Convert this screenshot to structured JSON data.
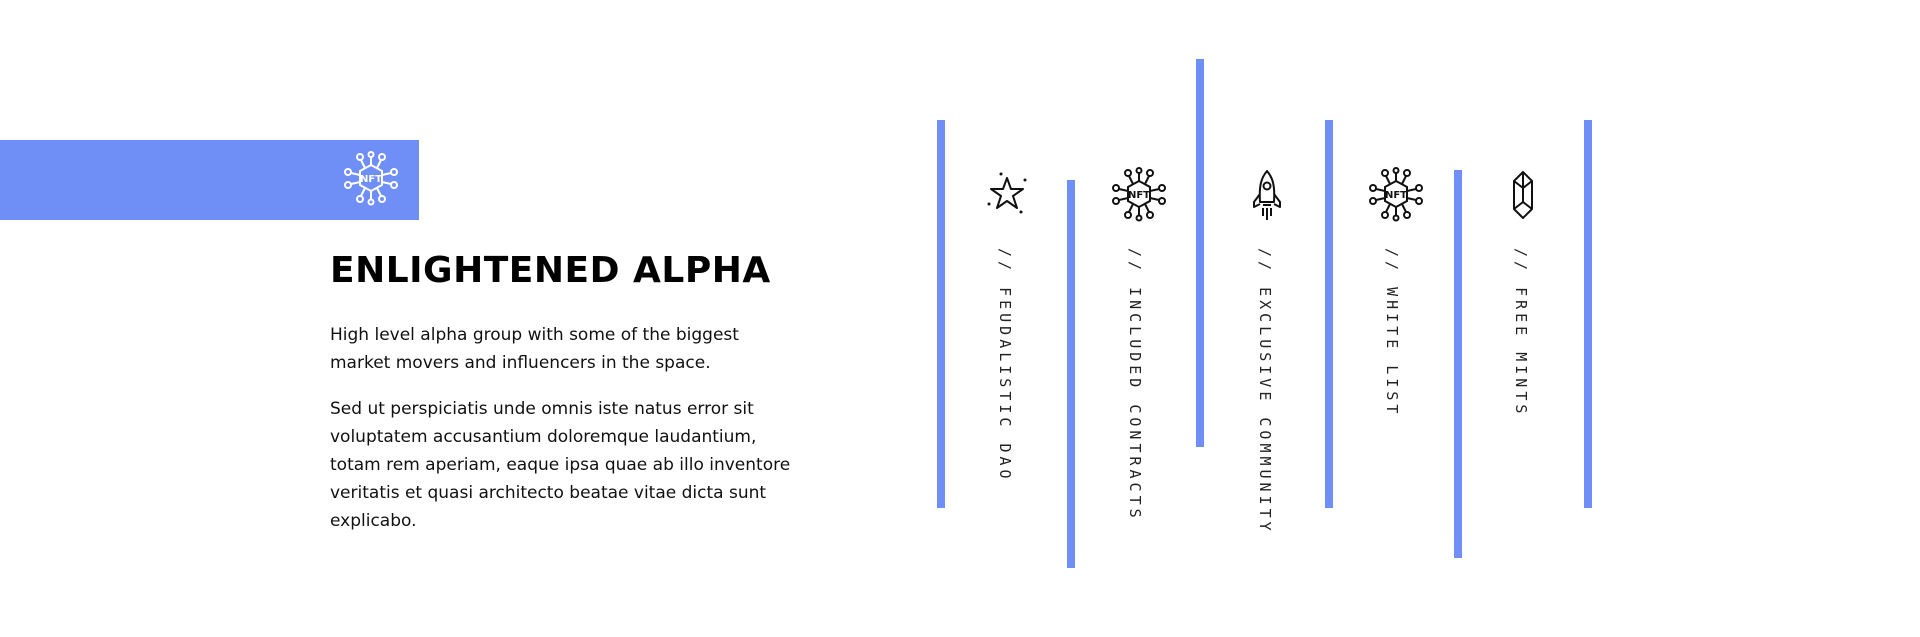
{
  "theme": {
    "accent": "#6f8ff6"
  },
  "banner": {
    "icon": "nft-network-icon",
    "icon_text": "NFT"
  },
  "heading": {
    "title": "Enlightened Alpha"
  },
  "body": {
    "paragraph1": "High level alpha group with some of the biggest market movers and influencers in the space.",
    "paragraph2": "Sed ut perspiciatis unde omnis iste natus error sit voluptatem accusantium doloremque laudantium, totam rem aperiam, eaque ipsa quae ab illo inventore veritatis et quasi architecto beatae vitae dicta sunt explicabo."
  },
  "features": [
    {
      "label": "// FEUDALISTIC DAO",
      "icon": "star-icon"
    },
    {
      "label": "// INCLUDED CONTRACTS",
      "icon": "nft-network-icon",
      "icon_text": "NFT"
    },
    {
      "label": "// EXCLUSIVE COMMUNITY",
      "icon": "rocket-icon"
    },
    {
      "label": "// WHITE LIST",
      "icon": "nft-network-icon",
      "icon_text": "NFT"
    },
    {
      "label": "// FREE MINTS",
      "icon": "crystal-icon"
    }
  ]
}
